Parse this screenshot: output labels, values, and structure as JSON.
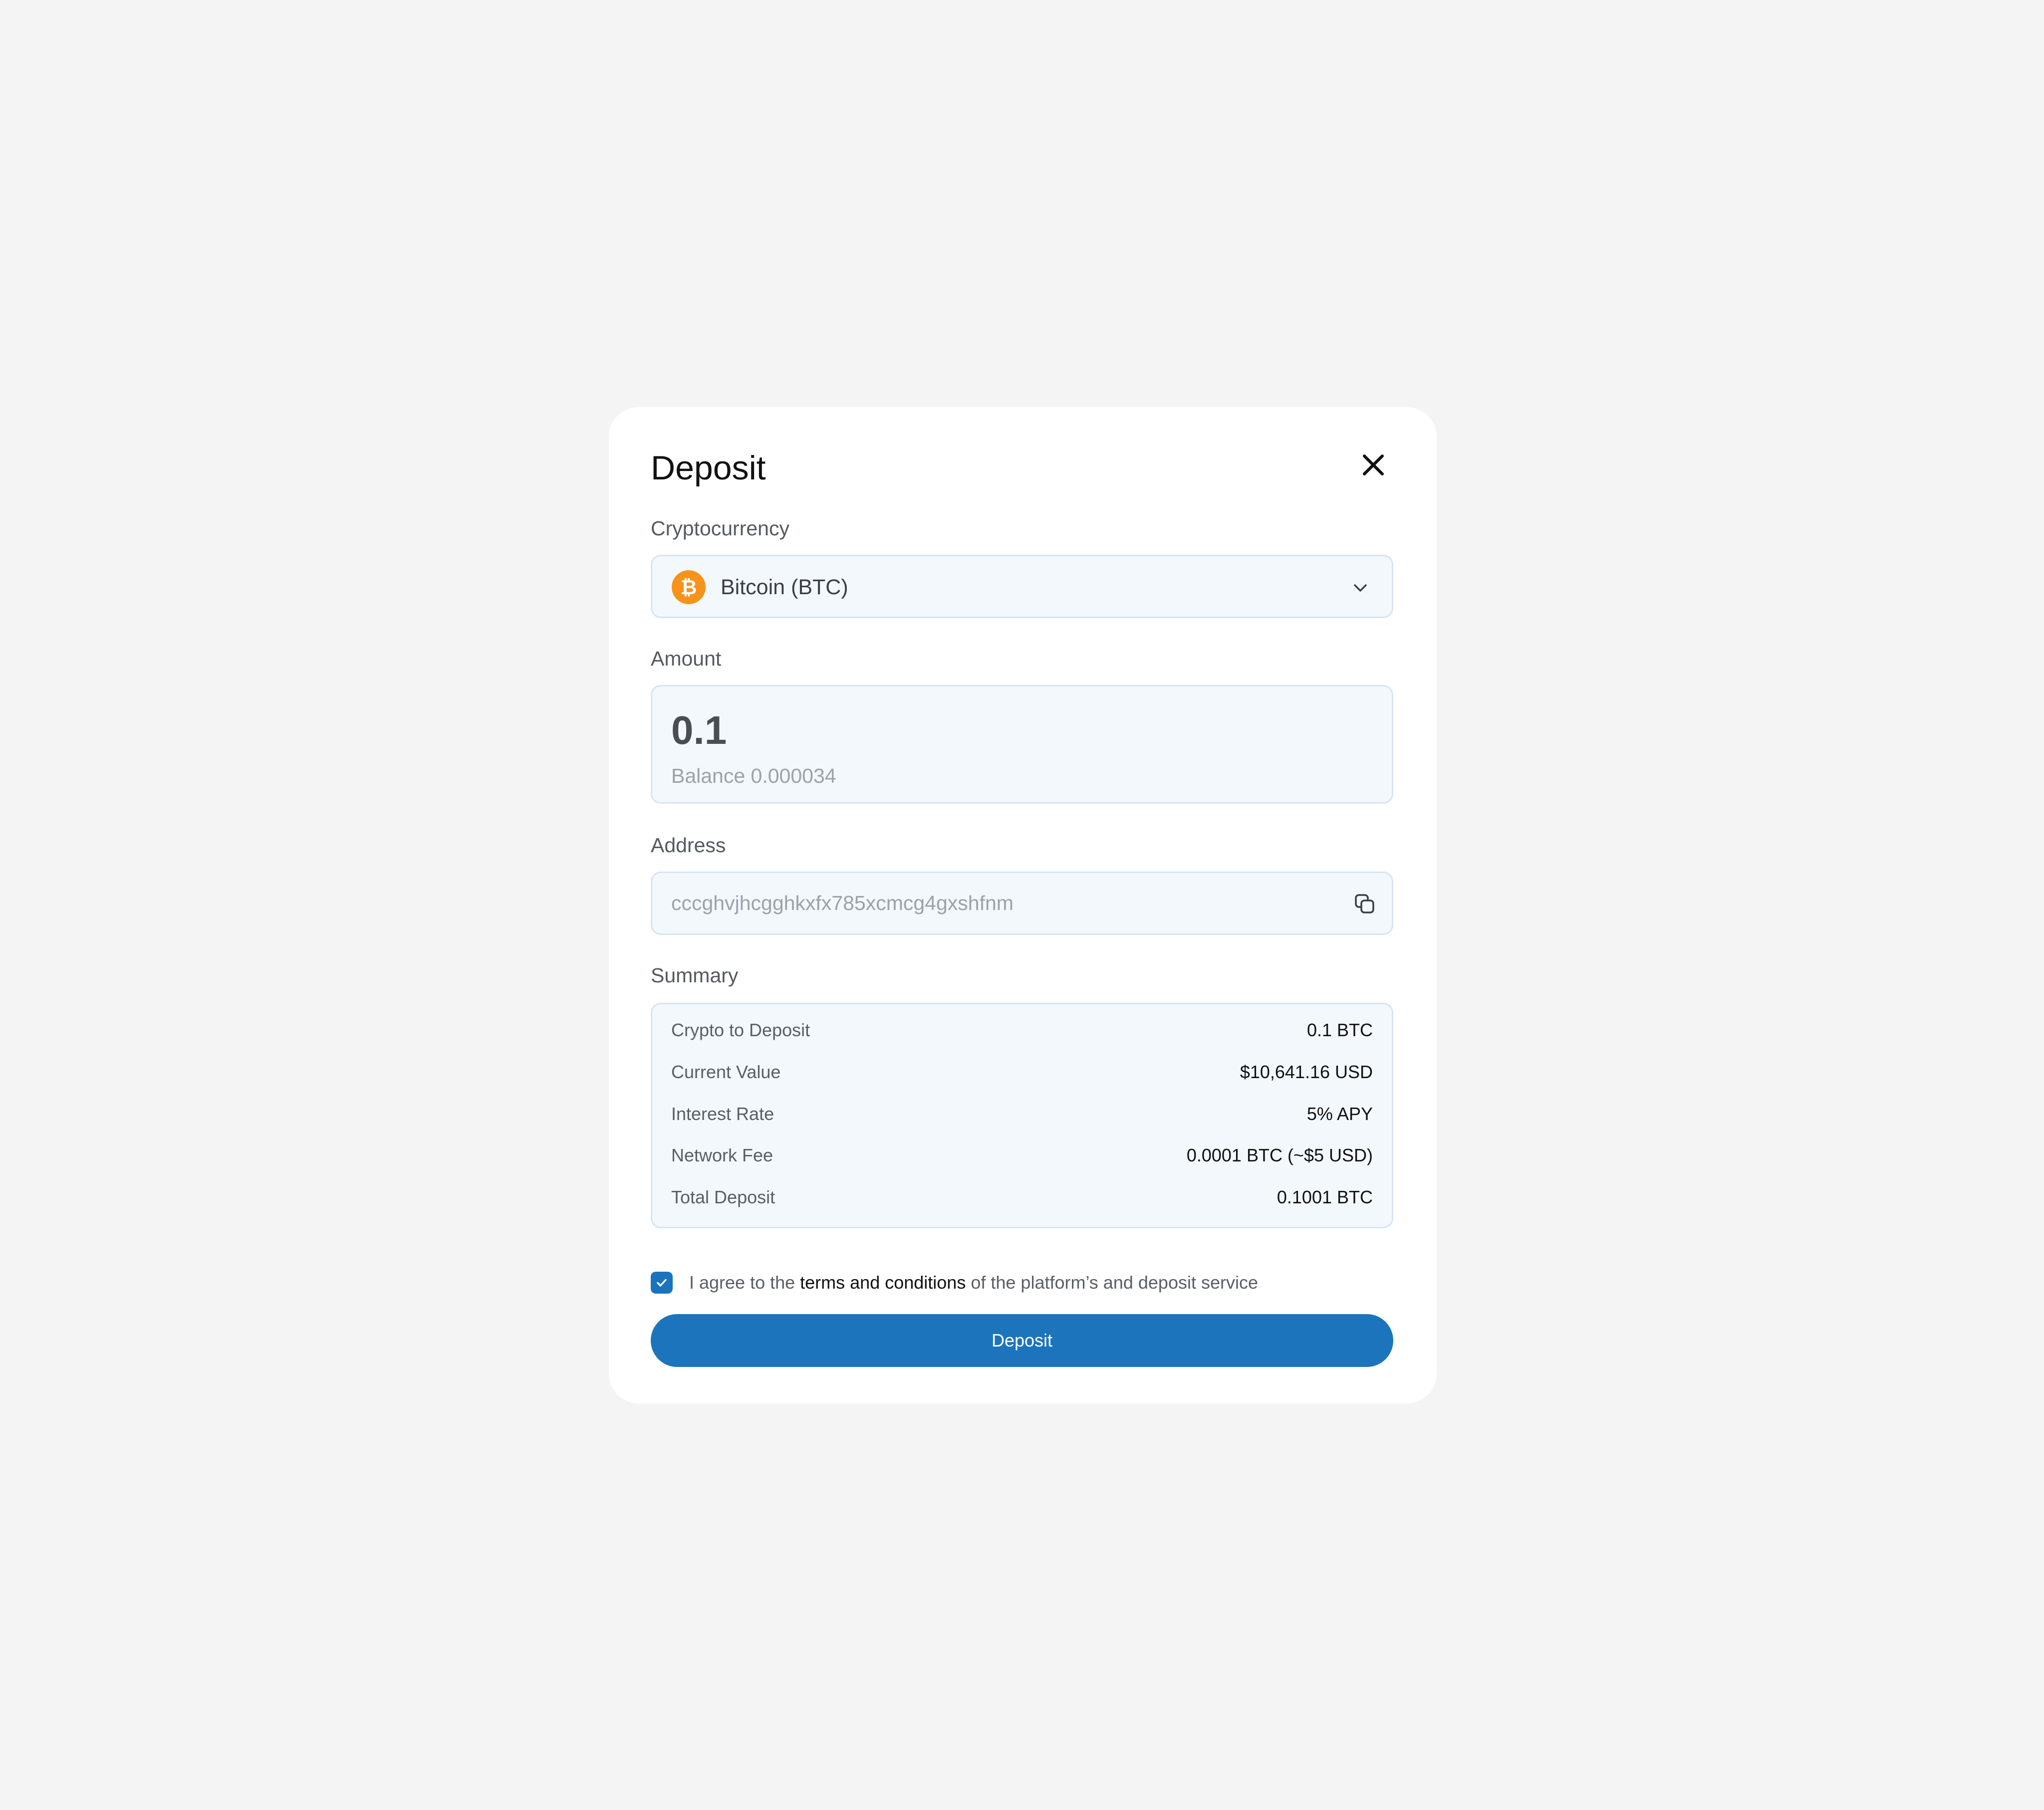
{
  "modal": {
    "title": "Deposit"
  },
  "cryptocurrency": {
    "label": "Cryptocurrency",
    "selected": "Bitcoin (BTC)",
    "icon": "bitcoin-icon",
    "icon_color": "#F7931A"
  },
  "amount": {
    "label": "Amount",
    "value": "0.1",
    "balance": "Balance 0.000034"
  },
  "address": {
    "label": "Address",
    "placeholder": "cccghvjhcgghkxfx785xcmcg4gxshfnm",
    "copy_icon": "copy-icon"
  },
  "summary": {
    "label": "Summary",
    "rows": [
      {
        "key": "Crypto to Deposit",
        "value": "0.1 BTC"
      },
      {
        "key": "Current Value",
        "value": "$10,641.16 USD"
      },
      {
        "key": "Interest Rate",
        "value": "5% APY"
      },
      {
        "key": "Network Fee",
        "value": "0.0001 BTC (~$5 USD)"
      },
      {
        "key": "Total Deposit",
        "value": "0.1001 BTC"
      }
    ]
  },
  "agreement": {
    "checked": true,
    "prefix": "I agree to the ",
    "link": "terms and conditions",
    "suffix": " of the platform’s and deposit service"
  },
  "actions": {
    "deposit_label": "Deposit"
  },
  "colors": {
    "background": "#F4F4F4",
    "accent": "#1C74BC",
    "field_bg": "#F3F8FD",
    "field_border": "#D6E5F3"
  }
}
